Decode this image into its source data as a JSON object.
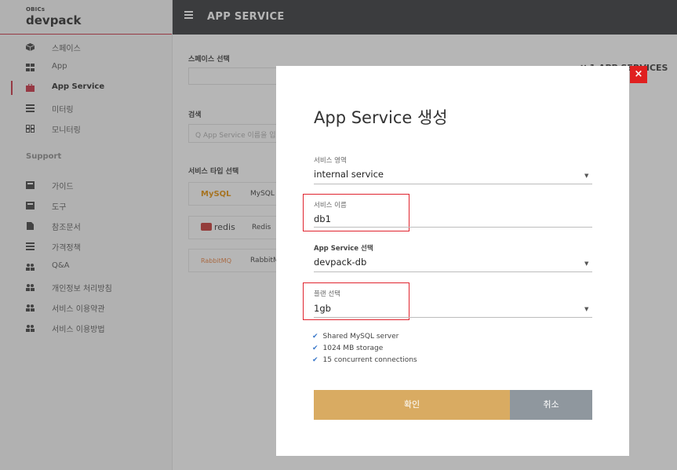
{
  "logo": {
    "small": "OBICs",
    "big": "devpack"
  },
  "header": {
    "title": "APP SERVICE"
  },
  "sidebar": {
    "items": [
      {
        "label": "스페이스",
        "icon": "cube-icon"
      },
      {
        "label": "App",
        "icon": "grid-icon"
      },
      {
        "label": "App Service",
        "icon": "briefcase-icon",
        "active": true
      },
      {
        "label": "미터링",
        "icon": "list-icon"
      },
      {
        "label": "모니터링",
        "icon": "dashboard-icon"
      }
    ],
    "support_label": "Support",
    "support_items": [
      {
        "label": "가이드",
        "icon": "book-icon"
      },
      {
        "label": "도구",
        "icon": "book-icon"
      },
      {
        "label": "참조문서",
        "icon": "document-icon"
      },
      {
        "label": "가격정책",
        "icon": "list-icon"
      },
      {
        "label": "Q&A",
        "icon": "users-icon"
      },
      {
        "label": "개인정보 처리방침",
        "icon": "users-icon"
      },
      {
        "label": "서비스 이용약관",
        "icon": "users-icon"
      },
      {
        "label": "서비스 이용방법",
        "icon": "users-icon"
      }
    ]
  },
  "background": {
    "space_select_label": "스페이스 선택",
    "search_label": "검색",
    "search_placeholder": "Q  App Service 이름을 입",
    "service_type_label": "서비스 타입 선택",
    "services": [
      {
        "logo": "MySQL",
        "name": "MySQL"
      },
      {
        "logo": "redis",
        "name": "Redis"
      },
      {
        "logo": "RabbitMQ",
        "name": "RabbitM"
      }
    ],
    "right_heading": "∷  1 APP SERVICES"
  },
  "modal": {
    "title": "App Service 생성",
    "close": "×",
    "fields": {
      "area": {
        "label": "서비스 영역",
        "value": "internal service"
      },
      "name": {
        "label": "서비스 이름",
        "value": "db1"
      },
      "app_service": {
        "label": "App Service 선택",
        "value": "devpack-db"
      },
      "plan": {
        "label": "플랜 선택",
        "value": "1gb"
      }
    },
    "features": [
      "Shared MySQL server",
      "1024 MB storage",
      "15 concurrent connections"
    ],
    "confirm_label": "확인",
    "cancel_label": "취소"
  },
  "colors": {
    "accent": "#c8293b",
    "confirm": "#d9ab62",
    "cancel": "#8f979e",
    "close": "#e02020",
    "highlight": "#e0242e"
  }
}
